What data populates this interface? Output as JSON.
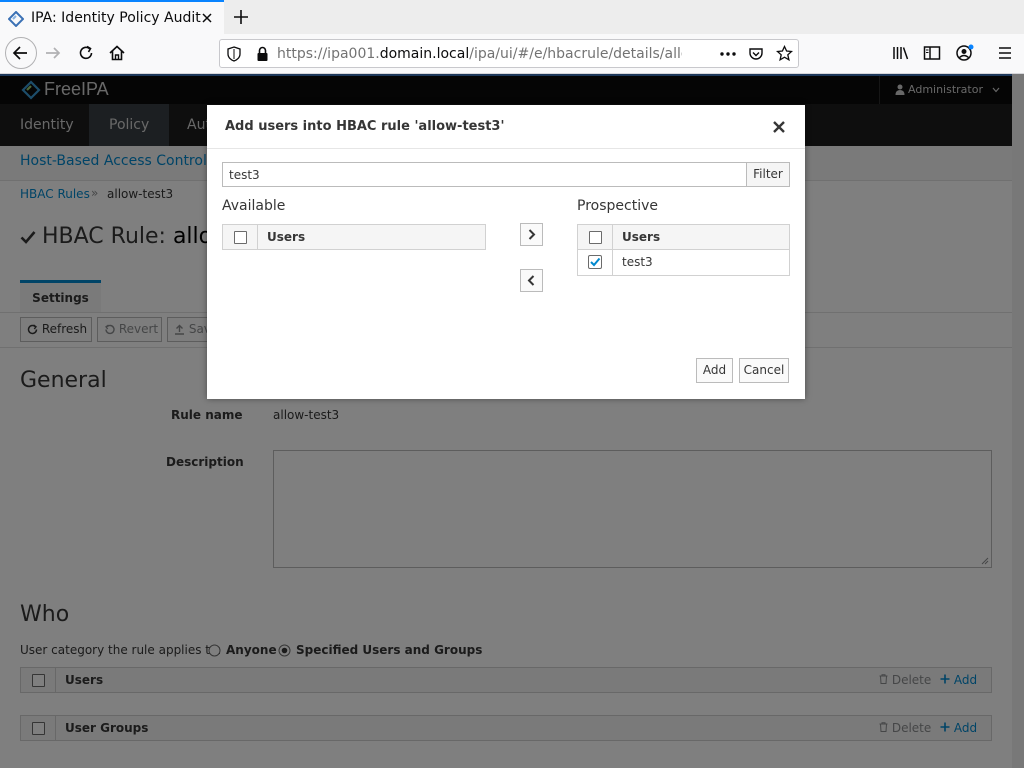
{
  "browser": {
    "tab_title": "IPA: Identity Policy Audit",
    "url_gray_prefix": "https://ipa001.",
    "url_domain": "domain.local",
    "url_path": "/ipa/ui/#/e/hbacrule/details/allow"
  },
  "header": {
    "logo": "FreeIPA",
    "user_menu": "Administrator"
  },
  "nav": {
    "items": [
      "Identity",
      "Policy",
      "Aut"
    ],
    "active": "Policy"
  },
  "subnav": {
    "section": "Host-Based Access Control"
  },
  "breadcrumb": {
    "parent": "HBAC Rules",
    "separator": "»",
    "current": "allow-test3"
  },
  "page": {
    "title_prefix": "HBAC Rule: ",
    "title_name": "allo",
    "tab": "Settings",
    "toolbar": {
      "refresh": "Refresh",
      "revert": "Revert",
      "save": "Sav"
    },
    "general": {
      "heading": "General",
      "rule_name_label": "Rule name",
      "rule_name_value": "allow-test3",
      "description_label": "Description"
    },
    "who": {
      "heading": "Who",
      "category_label": "User category the rule applies to:",
      "option_anyone": "Anyone",
      "option_specified": "Specified Users and Groups",
      "selected": "Specified Users and Groups",
      "users_table_header": "Users",
      "groups_table_header": "User Groups",
      "delete_label": "Delete",
      "add_label": "Add"
    }
  },
  "modal": {
    "title": "Add users into HBAC rule 'allow-test3'",
    "filter_value": "test3",
    "filter_button": "Filter",
    "available_heading": "Available",
    "available_column": "Users",
    "prospective_heading": "Prospective",
    "prospective_column": "Users",
    "prospective_rows": [
      {
        "name": "test3",
        "checked": true
      }
    ],
    "add_button": "Add",
    "cancel_button": "Cancel"
  },
  "colors": {
    "link": "#0088ce",
    "header_bg": "#0a0a0a",
    "nav_bg": "#1d1d1d",
    "nav_active_bg": "#393f44",
    "browser_accent": "#0a84ff"
  }
}
